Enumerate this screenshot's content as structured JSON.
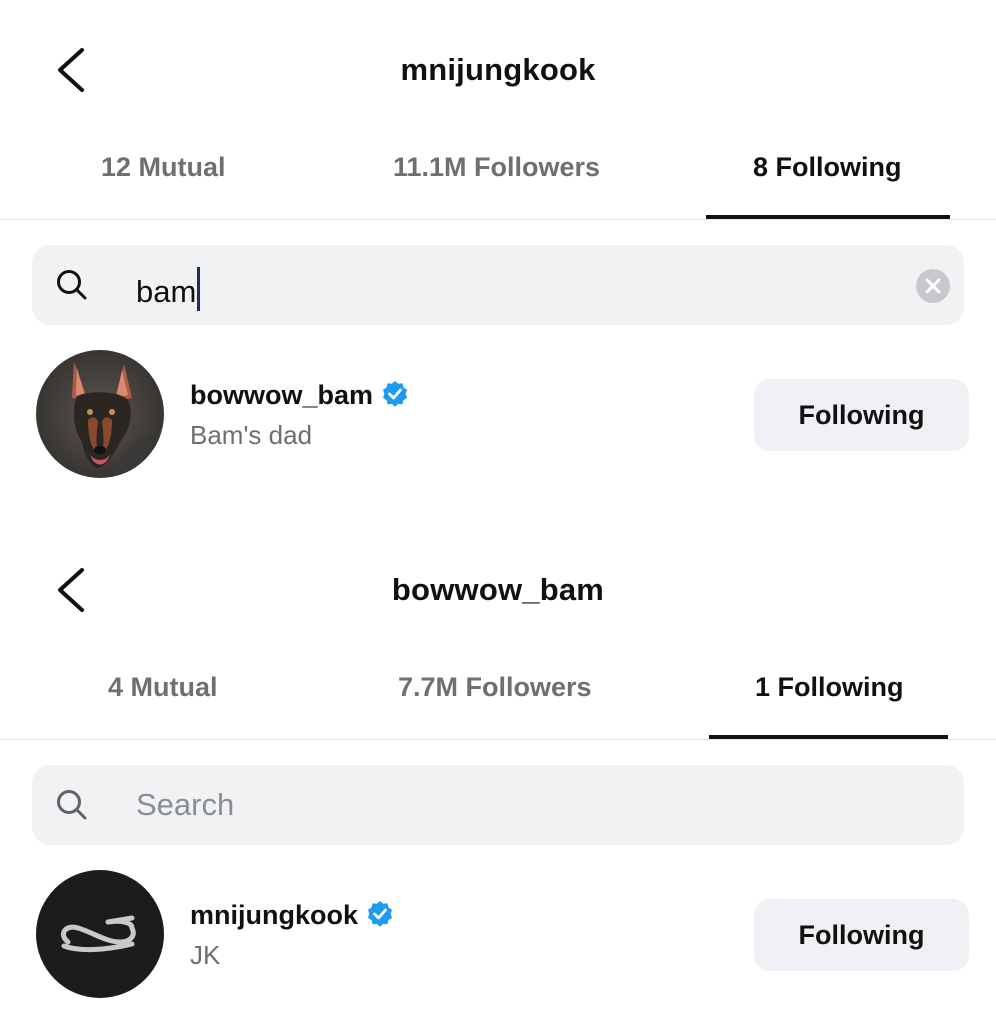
{
  "panel1": {
    "title": "mnijungkook",
    "tabs": [
      {
        "label": "12 Mutual"
      },
      {
        "label": "11.1M Followers"
      },
      {
        "label": "8 Following"
      }
    ],
    "search": {
      "value": "bam"
    },
    "result": {
      "username": "bowwow_bam",
      "full_name": "Bam's dad",
      "button": "Following"
    }
  },
  "panel2": {
    "title": "bowwow_bam",
    "tabs": [
      {
        "label": "4 Mutual"
      },
      {
        "label": "7.7M Followers"
      },
      {
        "label": "1 Following"
      }
    ],
    "search": {
      "placeholder": "Search"
    },
    "result": {
      "username": "mnijungkook",
      "full_name": "JK",
      "button": "Following"
    }
  },
  "colors": {
    "verified": "#1d9bf0",
    "search_bg": "#f1f2f4",
    "button_bg": "#f0f1f4",
    "inactive_tab": "#6f6f6f"
  },
  "icons": [
    "back-chevron-icon",
    "search-icon",
    "clear-icon",
    "verified-badge-icon"
  ]
}
